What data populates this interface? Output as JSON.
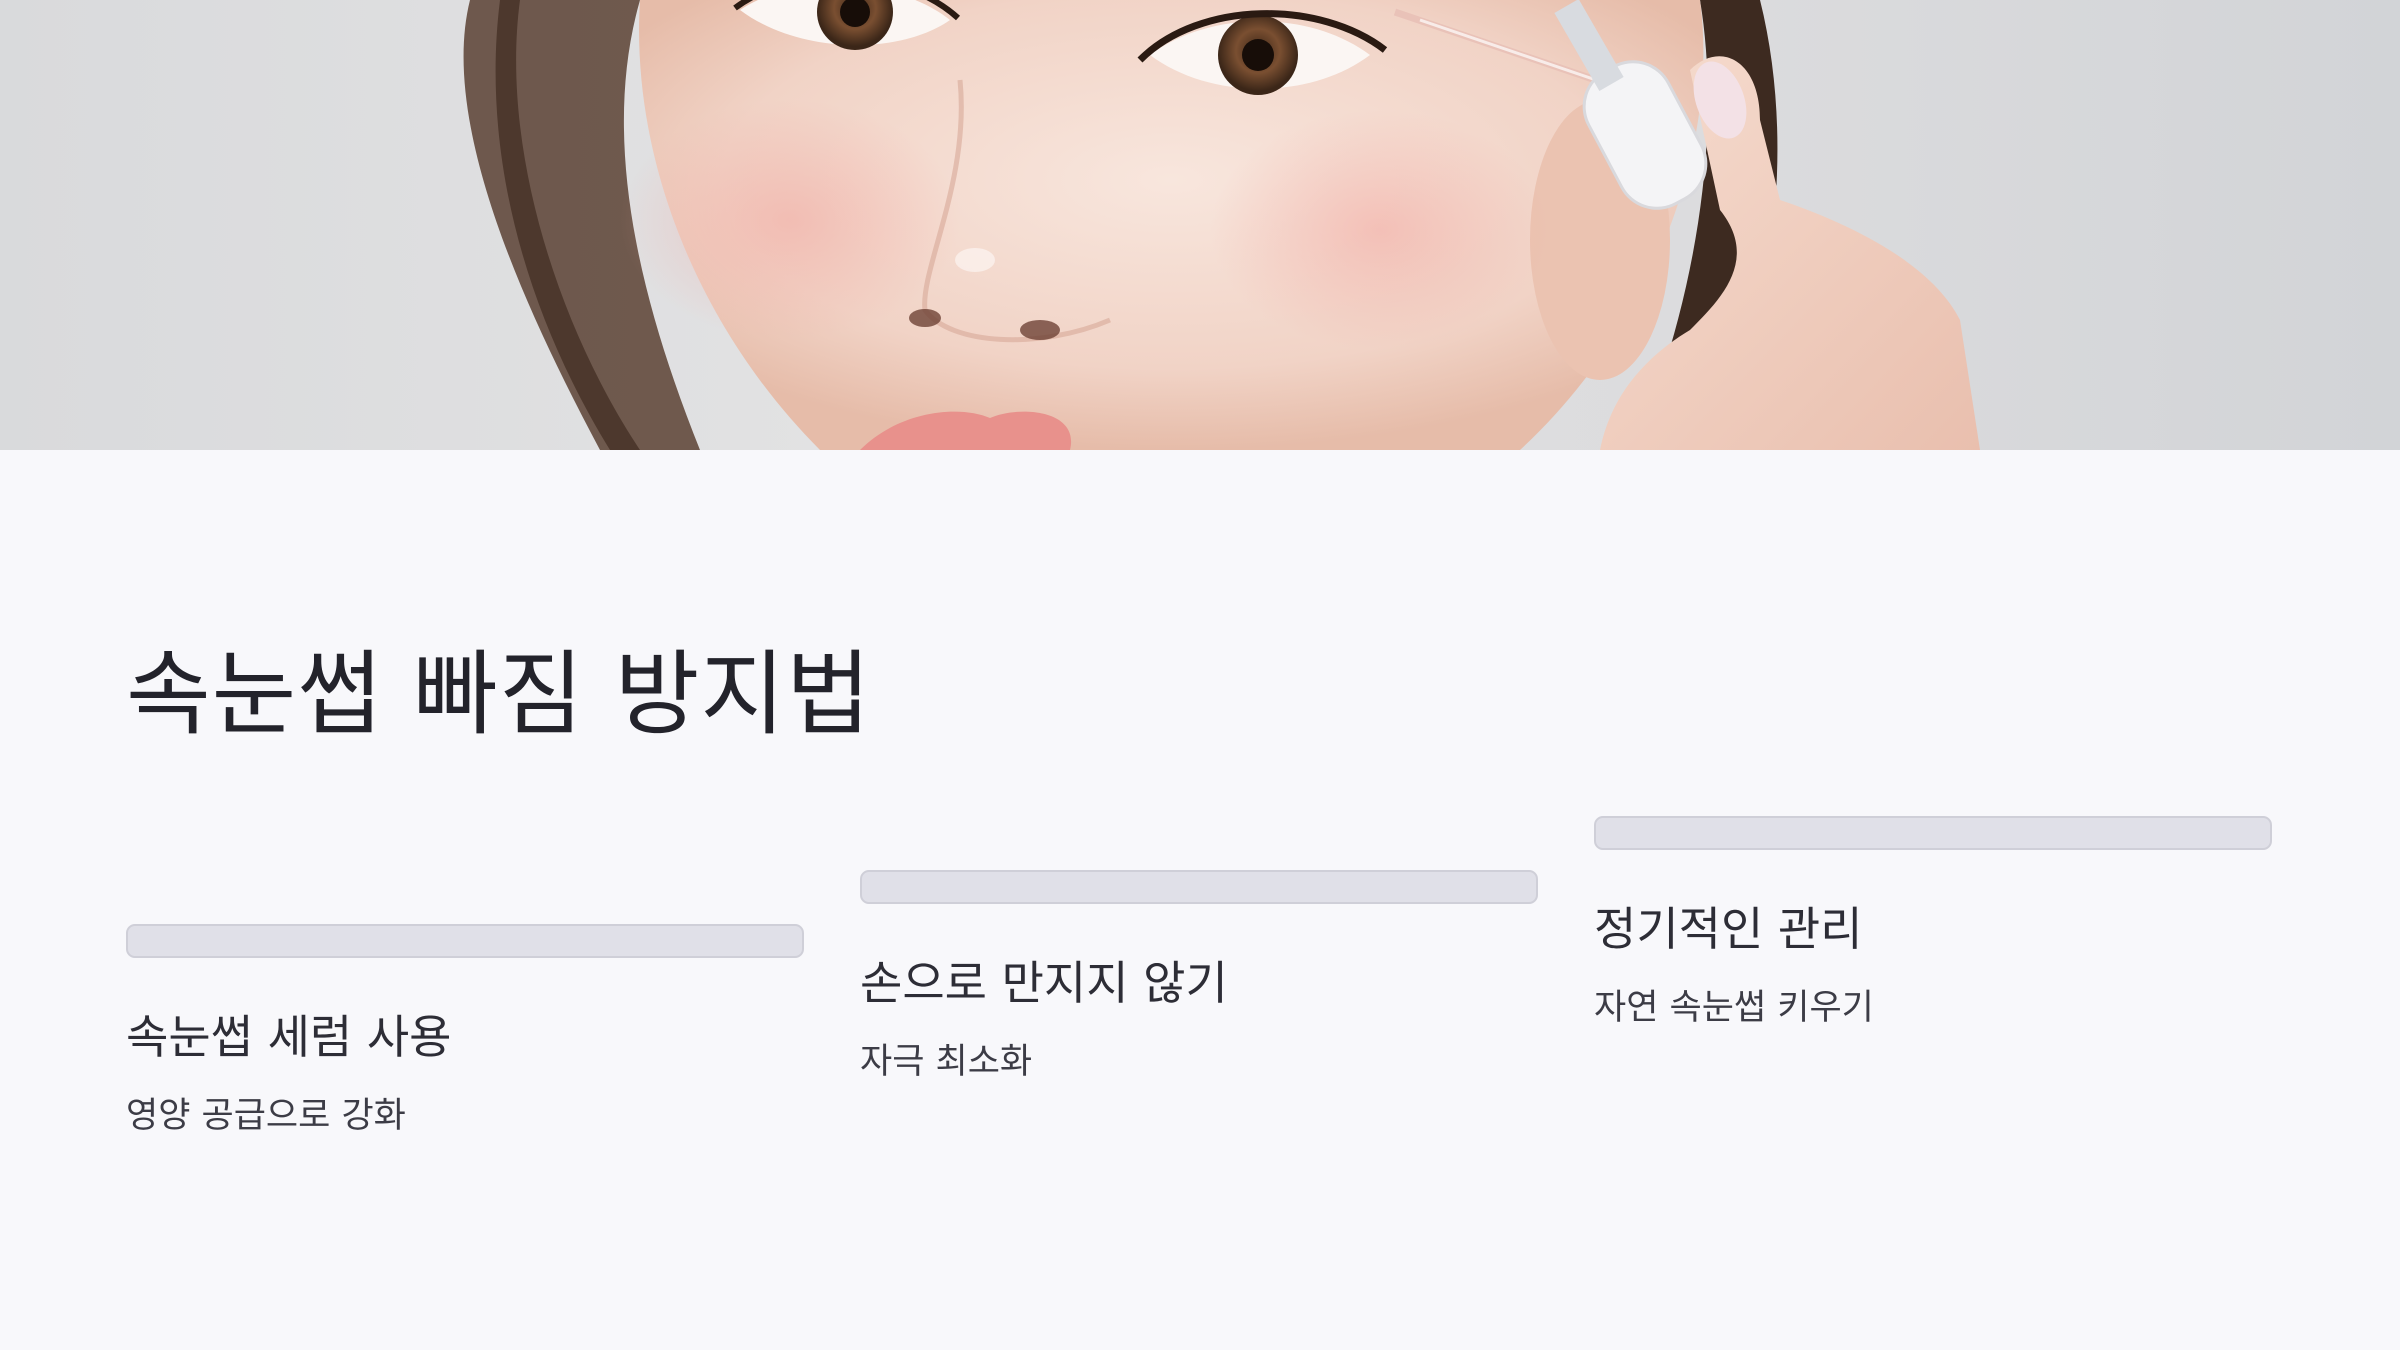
{
  "hero": {
    "image": "photo-woman-applying-eyelash-serum",
    "background_color": "#dcdcde"
  },
  "title": "속눈썹 빠짐 방지법",
  "items": [
    {
      "title": "속눈썹 세럼 사용",
      "description": "영양 공급으로 강화"
    },
    {
      "title": "손으로 만지지 않기",
      "description": "자극 최소화"
    },
    {
      "title": "정기적인 관리",
      "description": "자연 속눈썹 키우기"
    }
  ],
  "colors": {
    "page_background": "#f8f8fb",
    "bar_fill": "#e0e0e8",
    "bar_border": "#cfcfd8",
    "title_text": "#23232b",
    "body_text": "#2d2d36"
  }
}
